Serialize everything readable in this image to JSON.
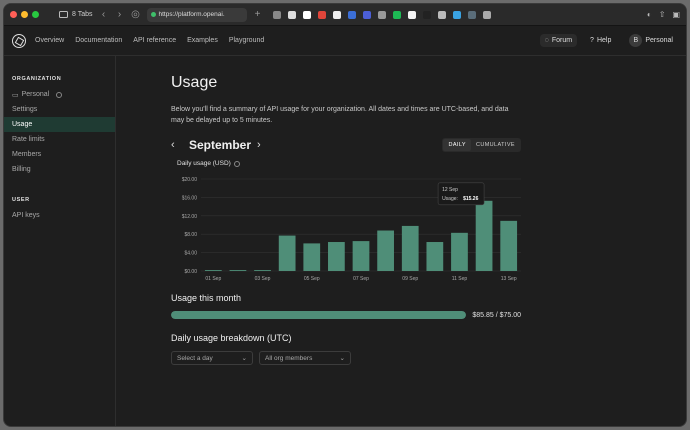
{
  "browser": {
    "tabs_label": "8 Tabs",
    "url": "https://platform.openai.",
    "favicons": [
      "n-icon",
      "ci-icon",
      "ext-icon",
      "red-icon",
      "edit-icon",
      "blue-icon",
      "circle-icon",
      "github-icon",
      "spotify-icon",
      "music-icon",
      "black-icon",
      "b-icon",
      "map-icon",
      "s-icon",
      "glasses-icon"
    ],
    "colors": {
      "close": "#ff5f57",
      "minimize": "#febc2e",
      "maximize": "#28c840"
    }
  },
  "header": {
    "nav": [
      "Overview",
      "Documentation",
      "API reference",
      "Examples",
      "Playground"
    ],
    "forum_label": "Forum",
    "help_label": "Help",
    "avatar_letter": "B",
    "personal_label": "Personal"
  },
  "sidebar": {
    "org_title": "ORGANIZATION",
    "org_name": "Personal",
    "items": [
      "Settings",
      "Usage",
      "Rate limits",
      "Members",
      "Billing"
    ],
    "active": "Usage",
    "user_title": "USER",
    "user_items": [
      "API keys"
    ]
  },
  "main": {
    "title": "Usage",
    "description": "Below you'll find a summary of API usage for your organization. All dates and times are UTC-based, and data may be delayed up to 5 minutes.",
    "month": "September",
    "toggle": {
      "daily": "DAILY",
      "cumulative": "CUMULATIVE"
    },
    "chart_title": "Daily usage (USD)",
    "usage_this_month_title": "Usage this month",
    "usage_text": "$85.85 / $75.00",
    "usage_progress": 1.0,
    "breakdown_title": "Daily usage breakdown (UTC)",
    "select_day_placeholder": "Select a day",
    "members_select": "All org members"
  },
  "chart_data": {
    "type": "bar",
    "title": "Daily usage (USD)",
    "categories": [
      "01 Sep",
      "02 Sep",
      "03 Sep",
      "04 Sep",
      "05 Sep",
      "06 Sep",
      "07 Sep",
      "08 Sep",
      "09 Sep",
      "10 Sep",
      "11 Sep",
      "12 Sep",
      "13 Sep"
    ],
    "x_tick_labels": [
      "01 Sep",
      "03 Sep",
      "05 Sep",
      "07 Sep",
      "09 Sep",
      "11 Sep",
      "13 Sep"
    ],
    "values": [
      0.2,
      0.2,
      0.2,
      7.7,
      6.0,
      6.3,
      6.5,
      8.8,
      9.8,
      6.3,
      8.3,
      15.26,
      10.9
    ],
    "y_ticks": [
      "$0.00",
      "$4.00",
      "$8.00",
      "$12.00",
      "$16.00",
      "$20.00"
    ],
    "ylim": [
      0,
      20
    ],
    "bar_color": "#4f8e78",
    "grid": true,
    "tooltip": {
      "date": "12 Sep",
      "label": "Usage:",
      "value": "$15.26"
    }
  }
}
